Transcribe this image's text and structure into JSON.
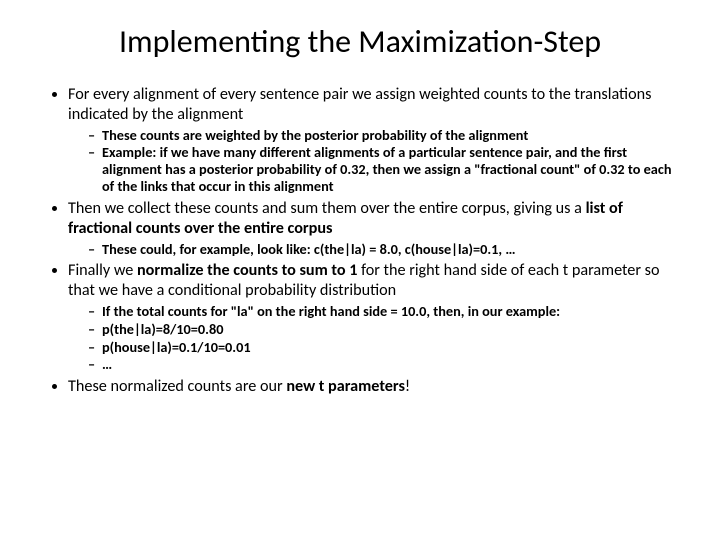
{
  "title": "Implementing the Maximization-Step",
  "b1": {
    "text": "For every alignment of every sentence pair we assign weighted counts to the translations indicated by the alignment",
    "sub": [
      "These counts are weighted by the posterior probability of the alignment",
      "Example: if we have many different alignments of a particular sentence pair, and the first alignment has a posterior probability of 0.32, then we assign a \"fractional count\" of 0.32 to each of the links that occur in this alignment"
    ]
  },
  "b2": {
    "p1": "Then we collect these counts and sum them over the entire corpus, giving us a ",
    "p2": "list of fractional counts over the entire corpus",
    "sub": [
      "These could, for example, look like: c(the|la) = 8.0, c(house|la)=0.1, …"
    ]
  },
  "b3": {
    "p1": "Finally we ",
    "p2": "normalize the counts to sum to 1",
    "p3": " for the right hand side of each t parameter so that we have a conditional probability distribution",
    "sub": [
      "If the total counts for \"la\" on the right hand side = 10.0, then, in our example:",
      "p(the|la)=8/10=0.80",
      "p(house|la)=0.1/10=0.01",
      "…"
    ]
  },
  "b4": {
    "p1": "These normalized counts are our ",
    "p2": "new t parameters",
    "p3": "!"
  }
}
